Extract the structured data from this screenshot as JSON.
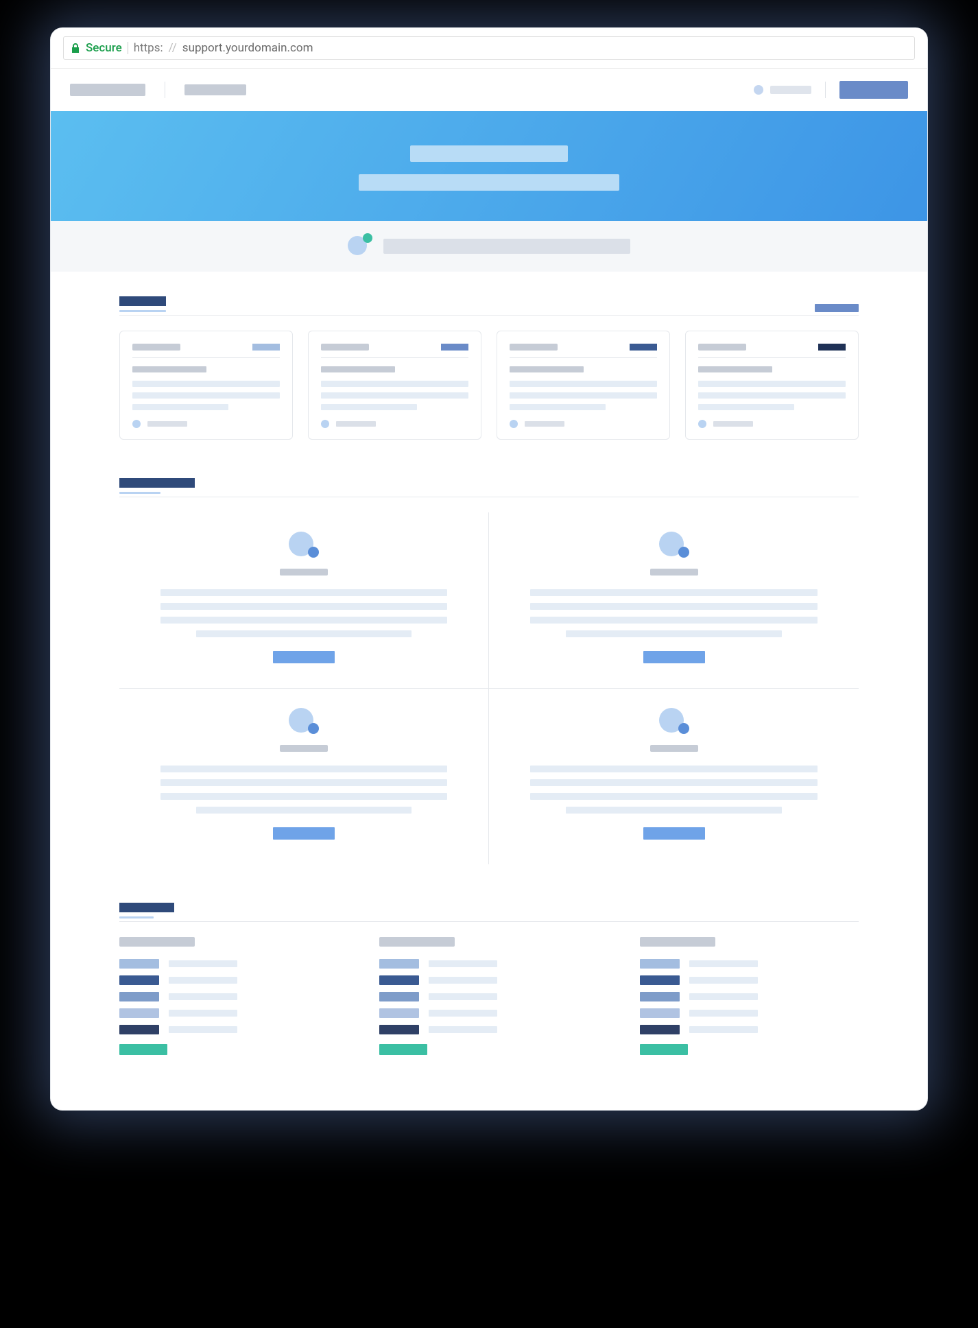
{
  "browser": {
    "secure_label": "Secure",
    "protocol": "https:",
    "slashes": "//",
    "domain": "support.yourdomain.com"
  },
  "topnav": {
    "logo": "",
    "nav_item": "",
    "user_name": "",
    "primary_button": ""
  },
  "hero": {
    "title": "",
    "subtitle": ""
  },
  "search": {
    "placeholder": ""
  },
  "tickets_section": {
    "title": "",
    "view_all": "",
    "cards": [
      {
        "title": "",
        "tag": "",
        "tag_color": "#a3bde0",
        "subtitle": "",
        "author": ""
      },
      {
        "title": "",
        "tag": "",
        "tag_color": "#6a8bc8",
        "subtitle": "",
        "author": ""
      },
      {
        "title": "",
        "tag": "",
        "tag_color": "#3a5a92",
        "subtitle": "",
        "author": ""
      },
      {
        "title": "",
        "tag": "",
        "tag_color": "#1f3156",
        "subtitle": "",
        "author": ""
      }
    ]
  },
  "categories_section": {
    "title": "",
    "items": [
      {
        "name": "",
        "cta": ""
      },
      {
        "name": "",
        "cta": ""
      },
      {
        "name": "",
        "cta": ""
      },
      {
        "name": "",
        "cta": ""
      }
    ]
  },
  "lists_section": {
    "title": "",
    "columns": [
      {
        "heading": "",
        "rows": [
          {
            "tag_color": "#a3bde0",
            "text": ""
          },
          {
            "tag_color": "#3a5a92",
            "text": ""
          },
          {
            "tag_color": "#7e9cc9",
            "text": ""
          },
          {
            "tag_color": "#b0c3e2",
            "text": ""
          },
          {
            "tag_color": "#2f4066",
            "text": ""
          }
        ],
        "more": ""
      },
      {
        "heading": "",
        "rows": [
          {
            "tag_color": "#a3bde0",
            "text": ""
          },
          {
            "tag_color": "#3a5a92",
            "text": ""
          },
          {
            "tag_color": "#7e9cc9",
            "text": ""
          },
          {
            "tag_color": "#b0c3e2",
            "text": ""
          },
          {
            "tag_color": "#2f4066",
            "text": ""
          }
        ],
        "more": ""
      },
      {
        "heading": "",
        "rows": [
          {
            "tag_color": "#a3bde0",
            "text": ""
          },
          {
            "tag_color": "#3a5a92",
            "text": ""
          },
          {
            "tag_color": "#7e9cc9",
            "text": ""
          },
          {
            "tag_color": "#b0c3e2",
            "text": ""
          },
          {
            "tag_color": "#2f4066",
            "text": ""
          }
        ],
        "more": ""
      }
    ]
  },
  "colors": {
    "hero_gradient_from": "#5bbef0",
    "hero_gradient_to": "#3d95e6",
    "accent_blue": "#6a8bc8",
    "accent_teal": "#3bbfa3",
    "secure_green": "#1a9e4b"
  }
}
